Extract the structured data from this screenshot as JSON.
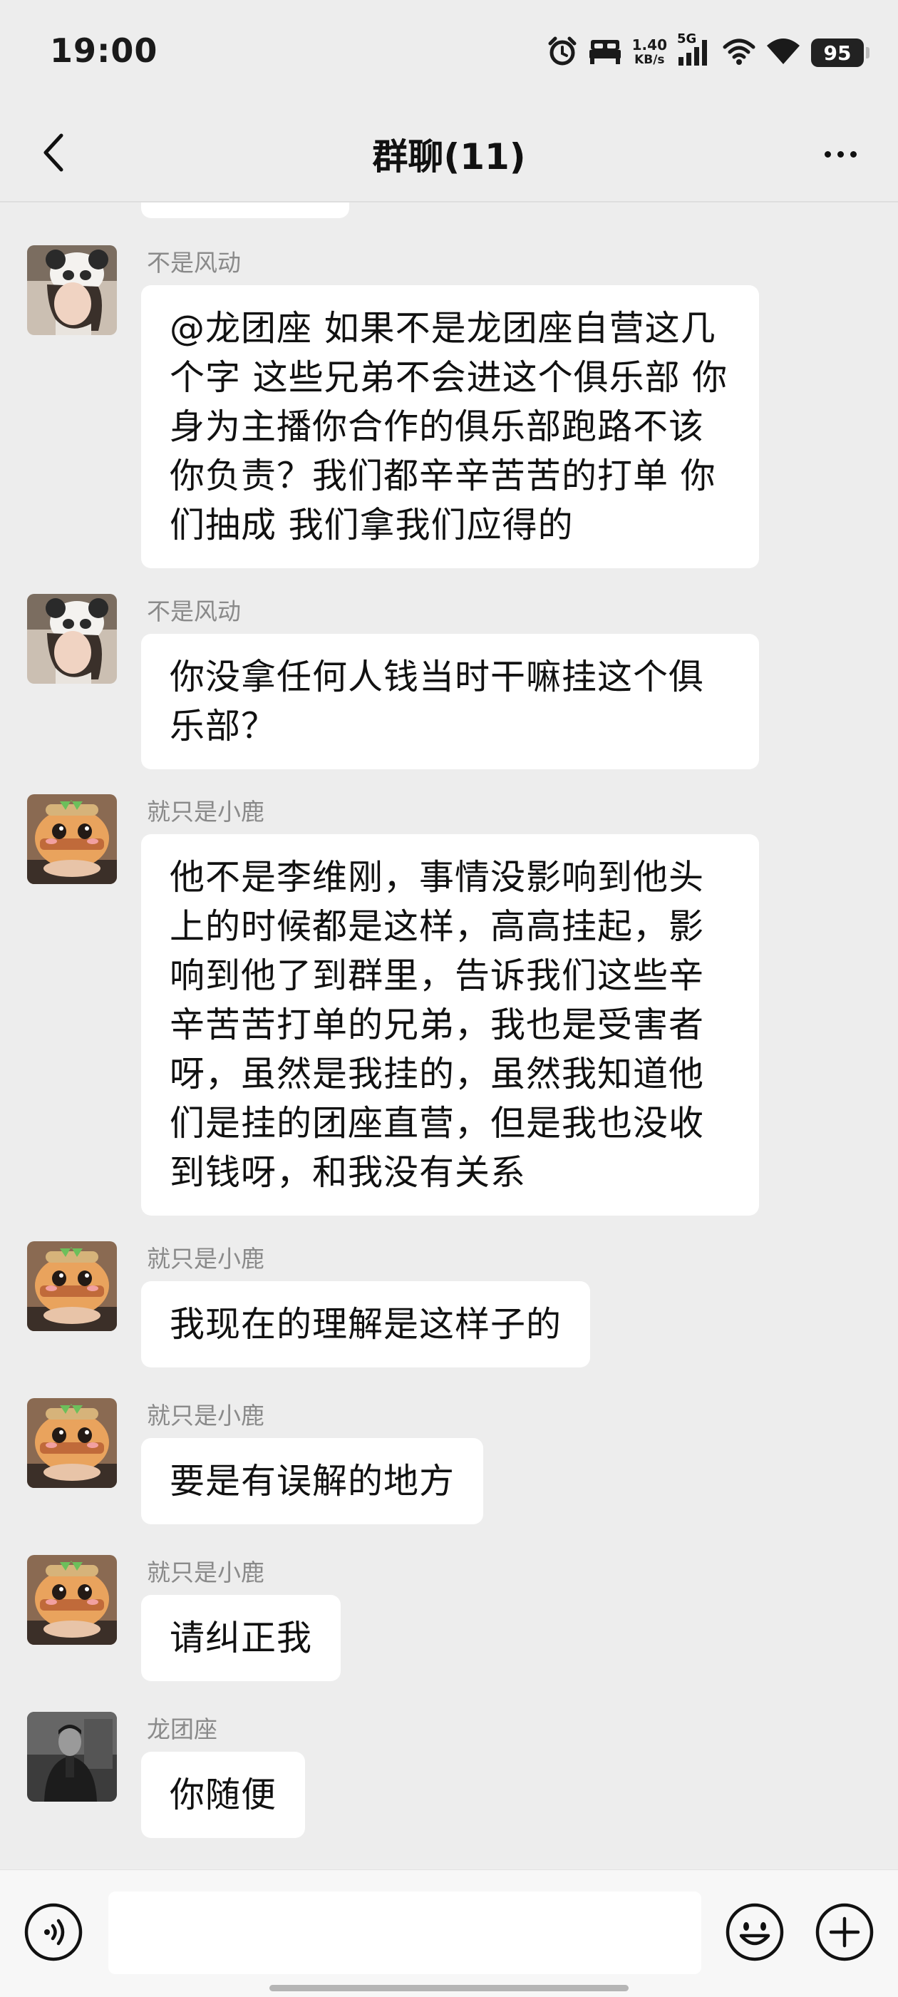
{
  "status_bar": {
    "time": "19:00",
    "net_speed_value": "1.40",
    "net_speed_unit": "KB/s",
    "network": "5G",
    "battery": "95",
    "icons": [
      "alarm-icon",
      "bed-icon",
      "signal-icon",
      "wifi-icon",
      "wifi-icon",
      "battery-icon"
    ]
  },
  "nav": {
    "title": "群聊(11)",
    "back_icon": "chevron-left-icon",
    "more_icon": "more-dots-icon"
  },
  "messages": [
    {
      "sender": "不是风动",
      "text": "@龙团座  如果不是龙团座自营这几个字 这些兄弟不会进这个俱乐部 你身为主播你合作的俱乐部跑路不该你负责？我们都辛辛苦苦的打单 你们抽成 我们拿我们应得的"
    },
    {
      "sender": "不是风动",
      "text": "你没拿任何人钱当时干嘛挂这个俱乐部？"
    },
    {
      "sender": "就只是小鹿",
      "text": "他不是李维刚，事情没影响到他头上的时候都是这样，高高挂起，影响到他了到群里，告诉我们这些辛辛苦苦打单的兄弟，我也是受害者呀，虽然是我挂的，虽然我知道他们是挂的团座直营，但是我也没收到钱呀，和我没有关系"
    },
    {
      "sender": "就只是小鹿",
      "text": "我现在的理解是这样子的"
    },
    {
      "sender": "就只是小鹿",
      "text": "要是有误解的地方"
    },
    {
      "sender": "就只是小鹿",
      "text": "请纠正我"
    },
    {
      "sender": "龙团座",
      "text": "你随便"
    }
  ],
  "input_bar": {
    "value": "",
    "voice_icon": "voice-icon",
    "emoji_icon": "emoji-icon",
    "add_icon": "plus-icon"
  },
  "colors": {
    "background": "#ededed",
    "bubble": "#ffffff",
    "sender_name": "#8a8a8a"
  }
}
